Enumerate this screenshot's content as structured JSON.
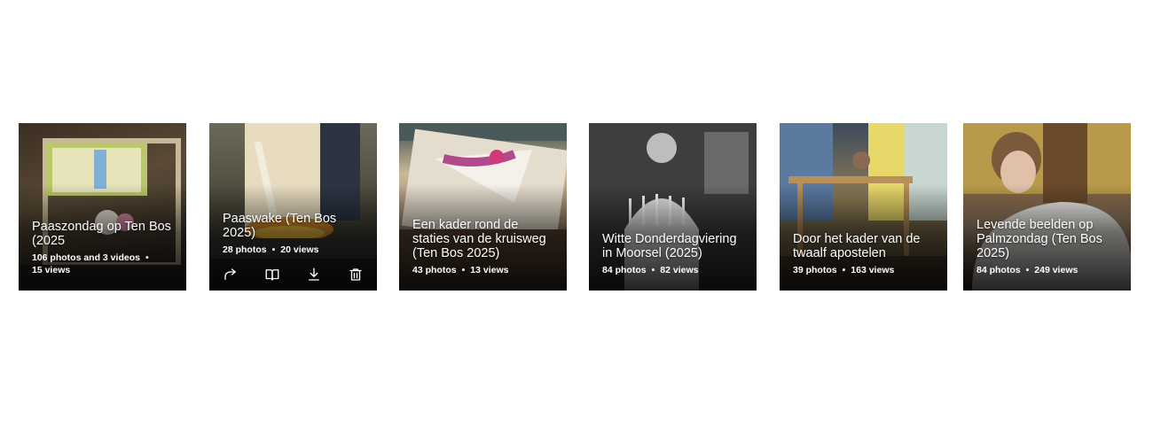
{
  "albums": [
    {
      "title": "Paaszondag op Ten Bos (2025",
      "meta_line1": "106 photos and 3 videos",
      "meta_line2": "15 views"
    },
    {
      "title": "Paaswake (Ten Bos 2025)",
      "photos": "28 photos",
      "views": "20 views"
    },
    {
      "title": "Een kader rond de staties van de kruisweg (Ten Bos 2025)",
      "photos": "43 photos",
      "views": "13 views"
    },
    {
      "title": "Witte Donderdagviering in Moorsel (2025)",
      "photos": "84 photos",
      "views": "82 views"
    },
    {
      "title": "Door het kader van de twaalf apostelen",
      "photos": "39 photos",
      "views": "163 views"
    },
    {
      "title": "Levende beelden op Palmzondag (Ten Bos 2025)",
      "photos": "84 photos",
      "views": "249 views"
    }
  ],
  "separator": "•",
  "hover_actions": [
    "share-icon",
    "book-icon",
    "download-icon",
    "trash-icon"
  ]
}
